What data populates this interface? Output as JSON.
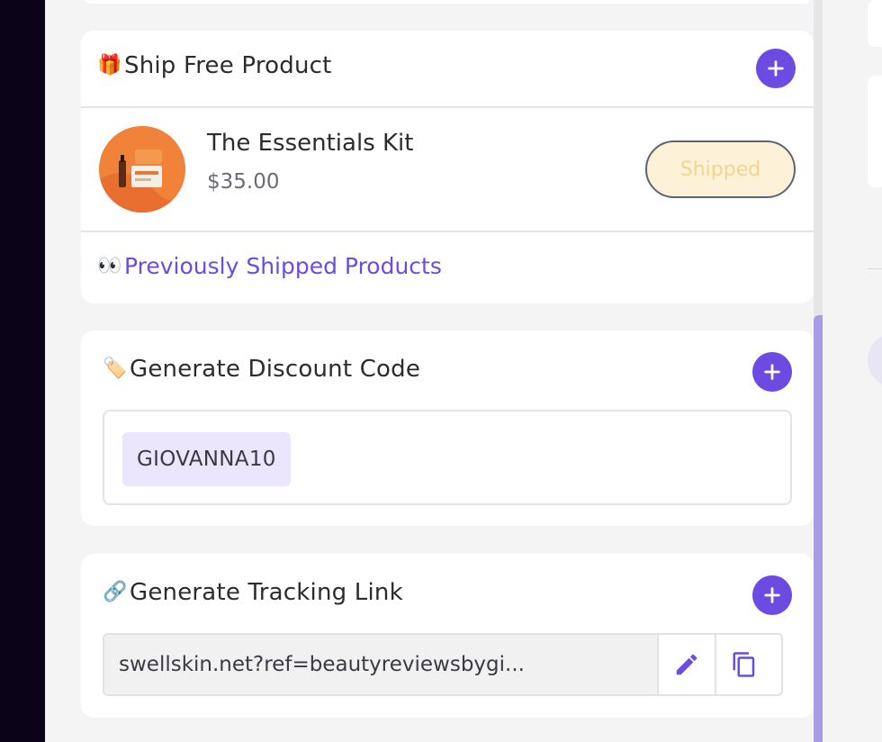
{
  "ship_card": {
    "emoji": "🎁",
    "title": "Ship Free Product",
    "add_icon": "plus-icon",
    "product": {
      "name": "The Essentials Kit",
      "price": "$35.00",
      "status": "Shipped"
    },
    "previous_emoji": "👀",
    "previous_link": "Previously Shipped Products"
  },
  "discount_card": {
    "emoji": "🏷️",
    "title": "Generate Discount Code",
    "add_icon": "plus-icon",
    "code": "GIOVANNA10"
  },
  "tracking_card": {
    "emoji": "🔗",
    "title": "Generate Tracking Link",
    "add_icon": "plus-icon",
    "link": "swellskin.net?ref=beautyreviewsbygi...",
    "edit_icon": "pencil-icon",
    "copy_icon": "copy-icon"
  },
  "colors": {
    "accent": "#6c4be3",
    "status_bg": "#fdf1d8",
    "status_text": "#f2d68e",
    "code_chip_bg": "#ebe6fb",
    "scroll_thumb": "#a99be6",
    "rail": "#0b0418"
  }
}
